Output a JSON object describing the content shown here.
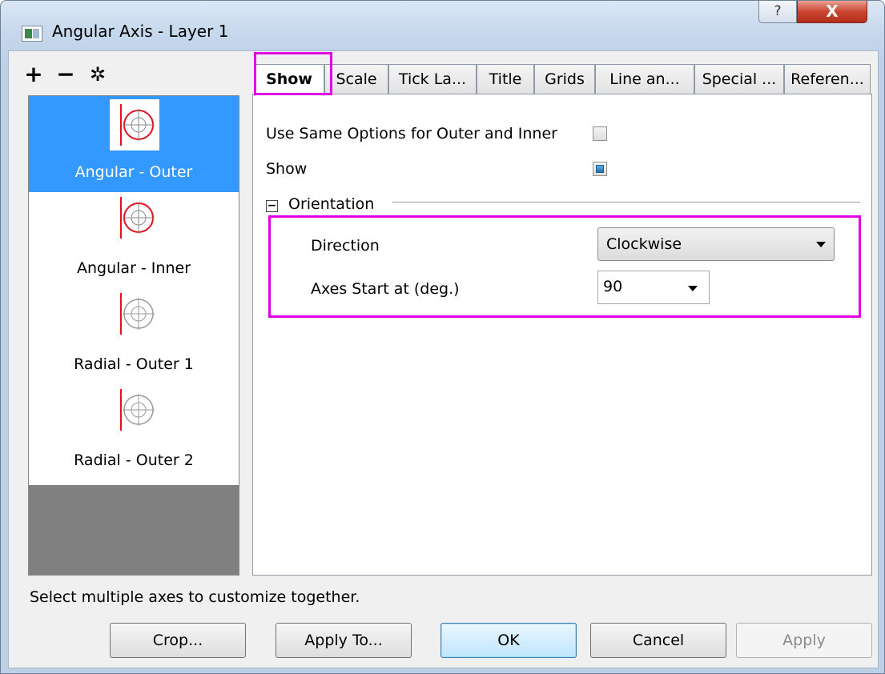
{
  "window": {
    "title": "Angular Axis - Layer 1",
    "help_label": "?",
    "close_label": "X"
  },
  "toolbar": {
    "add_label": "+",
    "remove_label": "−",
    "settings_label": "✲"
  },
  "axis_list": [
    {
      "label": "Angular - Outer",
      "selected": true,
      "icon": "polar-outer-angular-icon"
    },
    {
      "label": "Angular - Inner",
      "selected": false,
      "icon": "polar-inner-angular-icon"
    },
    {
      "label": "Radial - Outer 1",
      "selected": false,
      "icon": "polar-radial-icon"
    },
    {
      "label": "Radial - Outer 2",
      "selected": false,
      "icon": "polar-radial-icon"
    }
  ],
  "tabs": [
    {
      "label": "Show",
      "active": true
    },
    {
      "label": "Scale"
    },
    {
      "label": "Tick La..."
    },
    {
      "label": "Title"
    },
    {
      "label": "Grids"
    },
    {
      "label": "Line an..."
    },
    {
      "label": "Special ..."
    },
    {
      "label": "Referen..."
    }
  ],
  "show_tab": {
    "same_options_label": "Use Same Options for Outer and Inner",
    "same_options_checked": false,
    "show_label": "Show",
    "show_checked": true,
    "orientation_label": "Orientation",
    "orientation_toggle": "−",
    "direction_label": "Direction",
    "direction_value": "Clockwise",
    "start_label": "Axes Start at (deg.)",
    "start_value": "90"
  },
  "status": "Select multiple axes to customize together.",
  "buttons": {
    "crop": "Crop...",
    "apply_to": "Apply To...",
    "ok": "OK",
    "cancel": "Cancel",
    "apply": "Apply"
  },
  "colors": {
    "selection": "#3399ff",
    "highlight": "#e100e1",
    "icon_red": "#e0141e"
  }
}
